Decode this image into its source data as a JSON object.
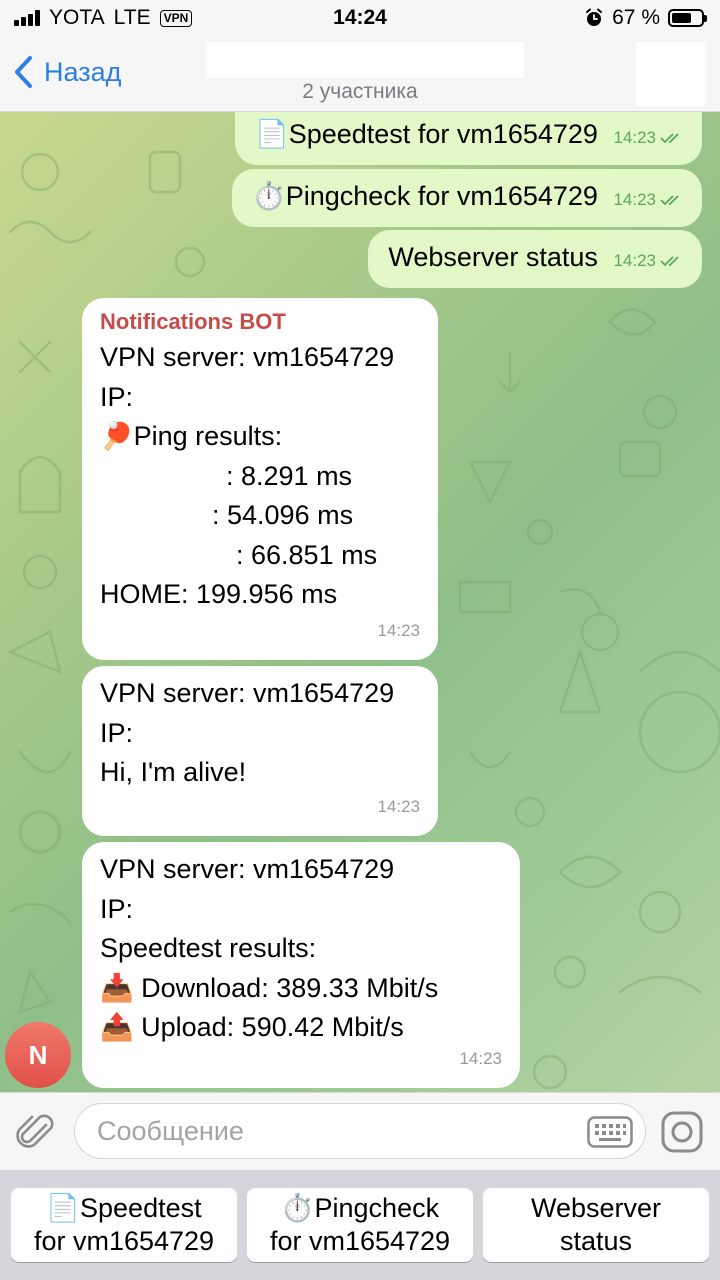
{
  "status_bar": {
    "carrier": "YOTA",
    "network": "LTE",
    "vpn": "VPN",
    "time": "14:24",
    "battery_text": "67 %",
    "battery_level": 0.67
  },
  "header": {
    "back_label": "Назад",
    "subtitle": "2 участника"
  },
  "outgoing": [
    {
      "emoji": "📄",
      "text": "Speedtest for vm1654729",
      "time": "14:23"
    },
    {
      "emoji": "⏱️",
      "text": "Pingcheck for vm1654729",
      "time": "14:23"
    },
    {
      "emoji": "",
      "text": "Webserver status",
      "time": "14:23"
    }
  ],
  "incoming": {
    "sender": "Notifications BOT",
    "avatar_letter": "N",
    "ping_message": {
      "lines": [
        "VPN server: vm1654729",
        "IP:",
        "",
        "🏓Ping results:",
        ": 8.291 ms",
        ": 54.096 ms",
        ": 66.851 ms",
        "HOME: 199.956 ms"
      ],
      "time": "14:23"
    },
    "alive_message": {
      "lines": [
        "VPN server: vm1654729",
        "IP:",
        "",
        "Hi, I'm alive!"
      ],
      "time": "14:23"
    },
    "speed_message": {
      "lines": [
        "VPN server: vm1654729",
        "IP:",
        "",
        "Speedtest results:",
        "📥 Download: 389.33 Mbit/s",
        "📤 Upload: 590.42 Mbit/s"
      ],
      "time": "14:23"
    }
  },
  "input": {
    "placeholder": "Сообщение"
  },
  "reply_keyboard": [
    {
      "line1": "📄Speedtest",
      "line2": "for vm1654729"
    },
    {
      "line1": "⏱️Pingcheck",
      "line2": "for vm1654729"
    },
    {
      "line1": "Webserver",
      "line2": "status"
    }
  ]
}
